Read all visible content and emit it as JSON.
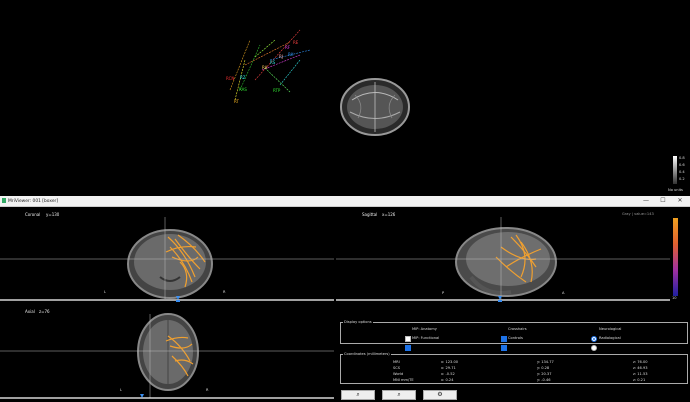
{
  "window": {
    "title": "MriViewer: 001 [boxer]",
    "minimize": "—",
    "maximize": "☐",
    "close": "✕"
  },
  "view3d": {
    "labels": [
      "RE",
      "RF",
      "RA",
      "RJ",
      "RP",
      "RX",
      "RS",
      "RB",
      "RD",
      "RC",
      "RZ",
      "RAS",
      "RT",
      "RTP",
      "RCN"
    ],
    "colorbar_ticks": [
      "0.8",
      "0.6",
      "0.4",
      "0.2"
    ],
    "units": "No units"
  },
  "coronal": {
    "title": "Coronal",
    "coord": "y=130",
    "left": "L",
    "right": "R"
  },
  "sagittal": {
    "title": "Sagittal",
    "coord": "x=126",
    "left": "P",
    "right": "A",
    "info": "Gray | value=143"
  },
  "axial": {
    "title": "Axial",
    "coord": "z=76",
    "left": "L",
    "right": "R"
  },
  "colorbar2": {
    "top": "",
    "bottom": "10"
  },
  "display_options": {
    "title": "Display options",
    "mip_anatomy": "MIP: Anatomy",
    "mip_functional": "MIP: Functional",
    "crosshairs": "Crosshairs",
    "contrasts": "Controls",
    "neurological": "Neurological",
    "radiological": "Radiological"
  },
  "coords": {
    "title": "Coordinates (millimeters)",
    "rows": [
      {
        "name": "MRI",
        "x": "x: 123.00",
        "y": "y: 134.77",
        "z": "z: 76.00"
      },
      {
        "name": "SCS",
        "x": "x: 29.71",
        "y": "y: 0.28",
        "z": "z: 46.93"
      },
      {
        "name": "World",
        "x": "x: -0.52",
        "y": "y: 20.37",
        "z": "z: 11.53"
      },
      {
        "name": "MNI mm/TE",
        "x": "x: 0.24",
        "y": "y: -0.46",
        "z": "z: 0.21"
      }
    ]
  },
  "buttons": [
    "⌕",
    "⌕",
    "⚙"
  ],
  "colors": {
    "accent": "#1e73e8",
    "fiber": "#f0a030"
  }
}
